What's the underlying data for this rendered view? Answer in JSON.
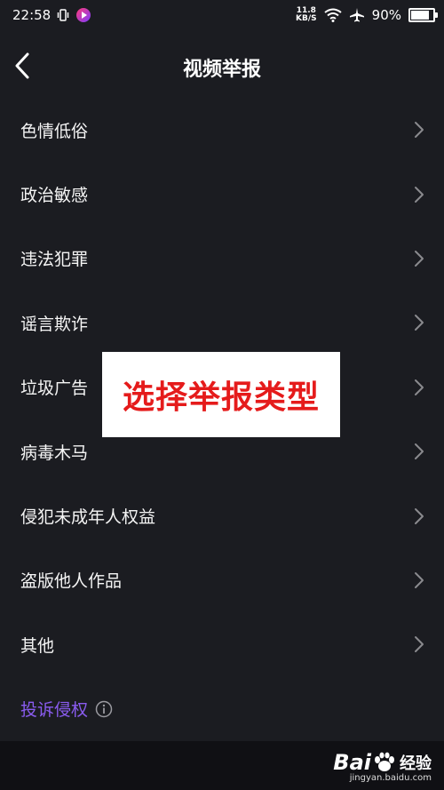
{
  "status_bar": {
    "time": "22:58",
    "net_speed_value": "11.8",
    "net_speed_unit": "KB/S",
    "battery": "90%",
    "battery_level": 0.9,
    "icons": [
      "vibrate-icon",
      "app-icon",
      "wifi-icon",
      "airplane-icon",
      "battery-icon"
    ]
  },
  "header": {
    "title": "视频举报",
    "back_icon": "chevron-left-icon"
  },
  "report_items": [
    {
      "label": "色情低俗"
    },
    {
      "label": "政治敏感"
    },
    {
      "label": "违法犯罪"
    },
    {
      "label": "谣言欺诈"
    },
    {
      "label": "垃圾广告"
    },
    {
      "label": "病毒木马"
    },
    {
      "label": "侵犯未成年人权益"
    },
    {
      "label": "盗版他人作品"
    },
    {
      "label": "其他"
    }
  ],
  "complaint": {
    "label": "投诉侵权",
    "icon": "info-icon"
  },
  "overlay": {
    "text": "选择举报类型"
  },
  "watermark": {
    "brand": "Bai",
    "brand_suffix": "经验",
    "url": "jingyan.baidu.com"
  },
  "colors": {
    "background": "#1b1c21",
    "accent_purple": "#8a5cf0",
    "overlay_red": "#e51b1b"
  }
}
